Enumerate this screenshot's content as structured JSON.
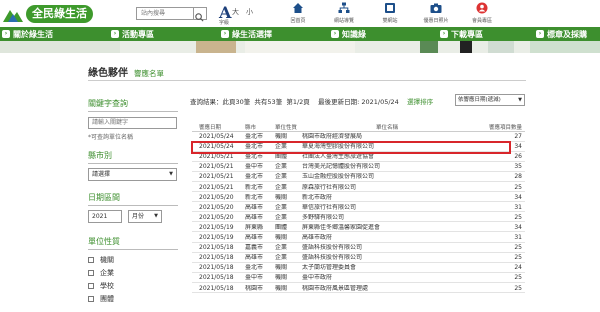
{
  "header": {
    "logo_text": "全民綠生活",
    "search_placeholder": "站內搜尋",
    "font": {
      "big": "A",
      "large": "大",
      "small": "小",
      "caption": "字級"
    },
    "icons": [
      {
        "label": "回首頁",
        "icon": "home-icon"
      },
      {
        "label": "網站導覽",
        "icon": "sitemap-icon"
      },
      {
        "label": "雙網站",
        "icon": "dual-site-icon"
      },
      {
        "label": "優惠日照片",
        "icon": "camera-icon"
      },
      {
        "label": "會員專區",
        "icon": "member-icon"
      }
    ]
  },
  "nav": {
    "items": [
      {
        "label": "關於綠生活"
      },
      {
        "label": "活動專區"
      },
      {
        "label": "綠生活選擇"
      },
      {
        "label": "知識綠"
      },
      {
        "label": "下載專區"
      },
      {
        "label": "標章及採購"
      }
    ]
  },
  "page": {
    "title": "綠色夥伴",
    "subtitle": "響應名單"
  },
  "sidebar": {
    "keyword_heading": "關鍵字查詢",
    "keyword_placeholder": "請輸入關鍵字",
    "keyword_note": "*可查詢單位名稱",
    "city_heading": "縣市別",
    "city_select": "請選擇",
    "date_heading": "日期區間",
    "year": "2021",
    "month": "月份",
    "unit_heading": "單位性質",
    "unit_types": [
      "機關",
      "企業",
      "學校",
      "團體"
    ]
  },
  "results": {
    "summary_prefix": "查詢結果：此頁30筆",
    "summary_total": "共有53筆",
    "summary_page": "第1/2頁",
    "updated_label": "最後更新日期: 2021/05/24",
    "sort_label": "選擇排序",
    "sort_value": "依響應日期(遞減)",
    "columns": [
      "響應日期",
      "縣市",
      "單位性質",
      "單位名稱",
      "響應項目數量"
    ],
    "rows": [
      [
        "2021/05/24",
        "臺北市",
        "機關",
        "桃園市政府經濟發展局",
        "27"
      ],
      [
        "2021/05/24",
        "臺北市",
        "企業",
        "華夏海灣塑膠股份有限公司",
        "34"
      ],
      [
        "2021/05/21",
        "臺北市",
        "團體",
        "社團法人臺灣生態旅遊協會",
        "26"
      ],
      [
        "2021/05/21",
        "臺中市",
        "企業",
        "台灣美光記憶體股份有限公司",
        "35"
      ],
      [
        "2021/05/21",
        "臺北市",
        "企業",
        "玉山金融控股股份有限公司",
        "28"
      ],
      [
        "2021/05/21",
        "新北市",
        "企業",
        "原森旅行社有限公司",
        "25"
      ],
      [
        "2021/05/20",
        "新北市",
        "機關",
        "新北市政府",
        "34"
      ],
      [
        "2021/05/20",
        "高雄市",
        "企業",
        "華信旅行社有限公司",
        "31"
      ],
      [
        "2021/05/20",
        "高雄市",
        "企業",
        "多野驛有限公司",
        "25"
      ],
      [
        "2021/05/19",
        "屏東縣",
        "團體",
        "屏東縣佳冬鄉溫馨家園促進會",
        "34"
      ],
      [
        "2021/05/19",
        "高雄市",
        "機關",
        "高雄市政府",
        "31"
      ],
      [
        "2021/05/18",
        "嘉義市",
        "企業",
        "盛語科技股份有限公司",
        "25"
      ],
      [
        "2021/05/18",
        "高雄市",
        "企業",
        "盛語科技股份有限公司",
        "25"
      ],
      [
        "2021/05/18",
        "臺北市",
        "機關",
        "太子蘭坊管理委員會",
        "24"
      ],
      [
        "2021/05/18",
        "臺中市",
        "機關",
        "臺中市政府",
        "25"
      ],
      [
        "2021/05/18",
        "桃園市",
        "機關",
        "桃園市政府風景區管理處",
        "25"
      ]
    ]
  },
  "colors": {
    "brand_green": "#3d8f2e",
    "highlight_red": "#d8262b"
  }
}
